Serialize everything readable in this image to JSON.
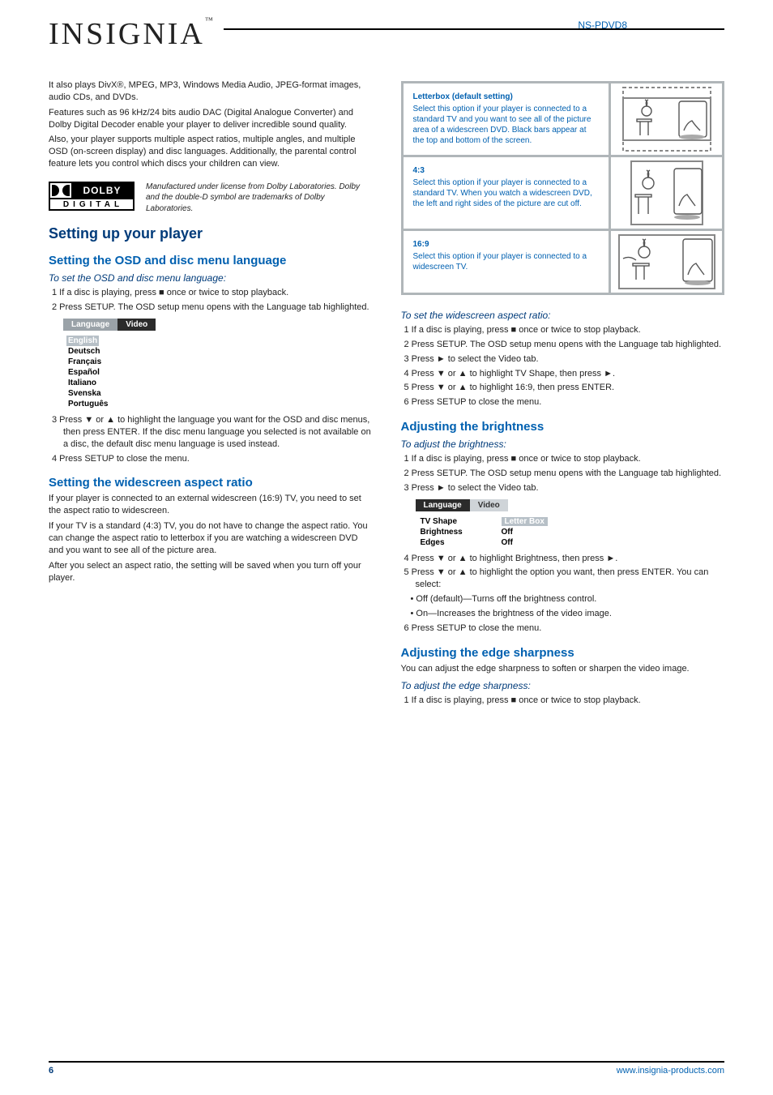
{
  "brand": "INSIGNIA",
  "brand_tm": "™",
  "model_header": "NS-PDVD8",
  "left": {
    "intro1": "It also plays DivX®, MPEG, MP3, Windows Media Audio, JPEG-format images, audio CDs, and DVDs.",
    "intro2": "Features such as 96 kHz/24 bits audio DAC (Digital Analogue Converter) and Dolby Digital Decoder enable your player to deliver incredible sound quality.",
    "intro3": "Also, your player supports multiple aspect ratios, multiple angles, and multiple OSD (on-screen display) and disc languages. Additionally, the parental control feature lets you control which discs your children can view.",
    "dolby": {
      "word": "DOLBY",
      "sub": "DIGITAL"
    },
    "dolby_note": "Manufactured under license from Dolby Laboratories. Dolby and the double-D symbol are trademarks of Dolby Laboratories."
  },
  "setup": {
    "head": "Setting up your player",
    "osd_head": "Setting the OSD and disc menu language",
    "osd_intro_em": "To set the OSD and disc menu language:",
    "osd_step1": "1 If a disc is playing, press ■ once or twice to stop playback.",
    "osd_step2": "2 Press SETUP. The OSD setup menu opens with the Language tab highlighted.",
    "osd_menu": {
      "tabs": [
        "Language",
        "Video"
      ],
      "items": [
        "English",
        "Deutsch",
        "Français",
        "Español",
        "Italiano",
        "Svenska",
        "Português"
      ]
    },
    "osd_step3": "3 Press ▼ or ▲ to highlight the language you want for the OSD and disc menus, then press ENTER. If the disc menu language you selected is not available on a disc, the default disc menu language is used instead.",
    "osd_step4": "4 Press SETUP to close the menu.",
    "aspect_head": "Setting the widescreen aspect ratio",
    "aspect_body1": "If your player is connected to an external widescreen (16:9) TV, you need to set the aspect ratio to widescreen.",
    "aspect_body2": "If your TV is a standard (4:3) TV, you do not have to change the aspect ratio. You can change the aspect ratio to letterbox if you are watching a widescreen DVD and you want to see all of the picture area.",
    "aspect_body3": "After you select an aspect ratio, the setting will be saved when you turn off your player."
  },
  "aspect_table": [
    {
      "title": "Letterbox (default setting)",
      "desc": "Select this option if your player is connected to a standard TV and you want to see all of the picture area of a widescreen DVD. Black bars appear at the top and bottom of the screen."
    },
    {
      "title": "4:3",
      "desc": "Select this option if your player is connected to a standard TV. When you watch a widescreen DVD, the left and right sides of the picture are cut off."
    },
    {
      "title": "16:9",
      "desc": "Select this option if your player is connected to a widescreen TV."
    }
  ],
  "right": {
    "ws_em": "To set the widescreen aspect ratio:",
    "ws_step1": "1 If a disc is playing, press ■ once or twice to stop playback.",
    "ws_step2": "2 Press SETUP. The OSD setup menu opens with the Language tab highlighted.",
    "ws_step3": "3 Press ► to select the Video tab.",
    "ws_step4": "4 Press ▼ or ▲ to highlight TV Shape, then press ►.",
    "ws_step5": "5 Press ▼ or ▲ to highlight 16:9, then press ENTER.",
    "ws_step6": "6 Press SETUP to close the menu.",
    "bright_head": "Adjusting the brightness",
    "bright_em": "To adjust the brightness:",
    "bright_step1": "1 If a disc is playing, press ■ once or twice to stop playback.",
    "bright_step2": "2 Press SETUP. The OSD setup menu opens with the Language tab highlighted.",
    "bright_step3": "3 Press ► to select the Video tab.",
    "video_menu": {
      "tabs": [
        "Language",
        "Video"
      ],
      "rows": [
        {
          "label": "TV Shape",
          "value": "Letter Box"
        },
        {
          "label": "Brightness",
          "value": "Off"
        },
        {
          "label": "Edges",
          "value": "Off"
        }
      ]
    },
    "bright_step4": "4 Press ▼ or ▲ to highlight Brightness, then press ►.",
    "bright_step5": "5 Press ▼ or ▲ to highlight the option you want, then press ENTER. You can select:",
    "bright_b1": "• Off (default)—Turns off the brightness control.",
    "bright_b2": "• On—Increases the brightness of the video image.",
    "bright_step6": "6 Press SETUP to close the menu.",
    "edge_head": "Adjusting the edge sharpness",
    "edge_p1": "You can adjust the edge sharpness to soften or sharpen the video image.",
    "edge_em": "To adjust the edge sharpness:",
    "edge_step1": "1 If a disc is playing, press ■ once or twice to stop playback."
  },
  "footer": {
    "page": "6",
    "url": "www.insignia-products.com"
  }
}
